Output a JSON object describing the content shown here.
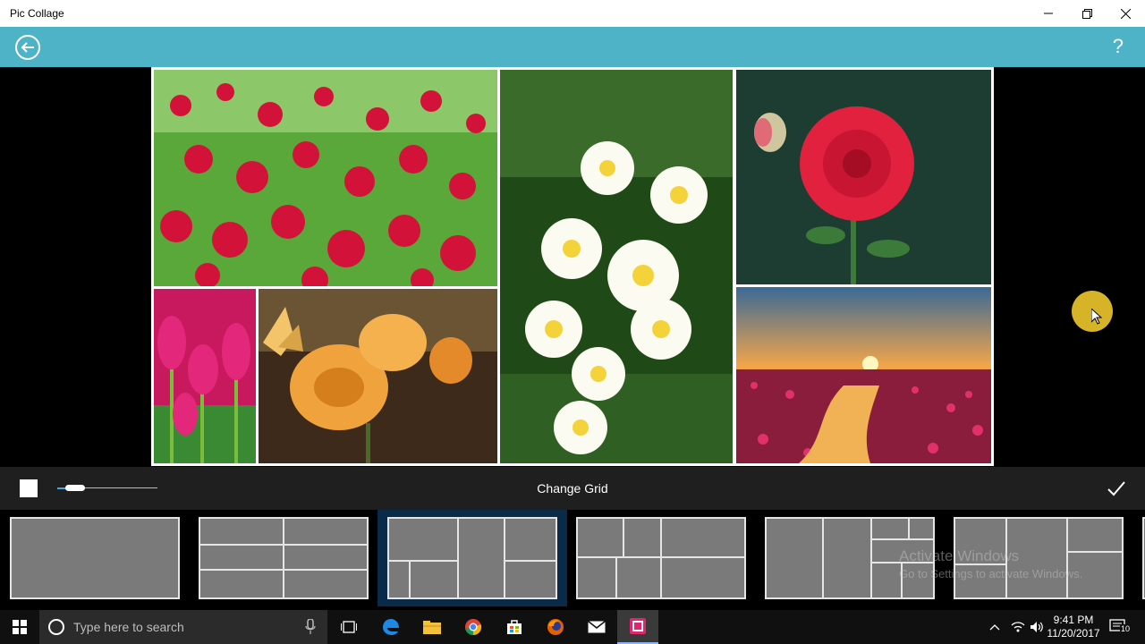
{
  "window": {
    "title": "Pic Collage"
  },
  "header": {
    "help_label": "?"
  },
  "toolbar": {
    "title": "Change Grid",
    "border_slider_value": 0.18,
    "swatch_color": "#ffffff"
  },
  "grid_options": [
    {
      "id": "grid-1",
      "selected": false
    },
    {
      "id": "grid-2",
      "selected": false
    },
    {
      "id": "grid-3",
      "selected": true
    },
    {
      "id": "grid-4",
      "selected": false
    },
    {
      "id": "grid-5",
      "selected": false
    },
    {
      "id": "grid-6",
      "selected": false
    }
  ],
  "collage_photos": [
    {
      "name": "red-daisies-photo"
    },
    {
      "name": "white-plumeria-photo"
    },
    {
      "name": "red-dahlia-photo"
    },
    {
      "name": "pink-tulips-photo"
    },
    {
      "name": "orange-roses-butterfly-photo"
    },
    {
      "name": "sunset-lotus-lake-photo"
    }
  ],
  "watermark": {
    "line1": "Activate Windows",
    "line2": "Go to Settings to activate Windows."
  },
  "taskbar": {
    "search_placeholder": "Type here to search",
    "time": "9:41 PM",
    "date": "11/20/2017",
    "notification_count": "10"
  },
  "colors": {
    "accent": "#4fb3c7",
    "selection": "#0a2a4a"
  }
}
